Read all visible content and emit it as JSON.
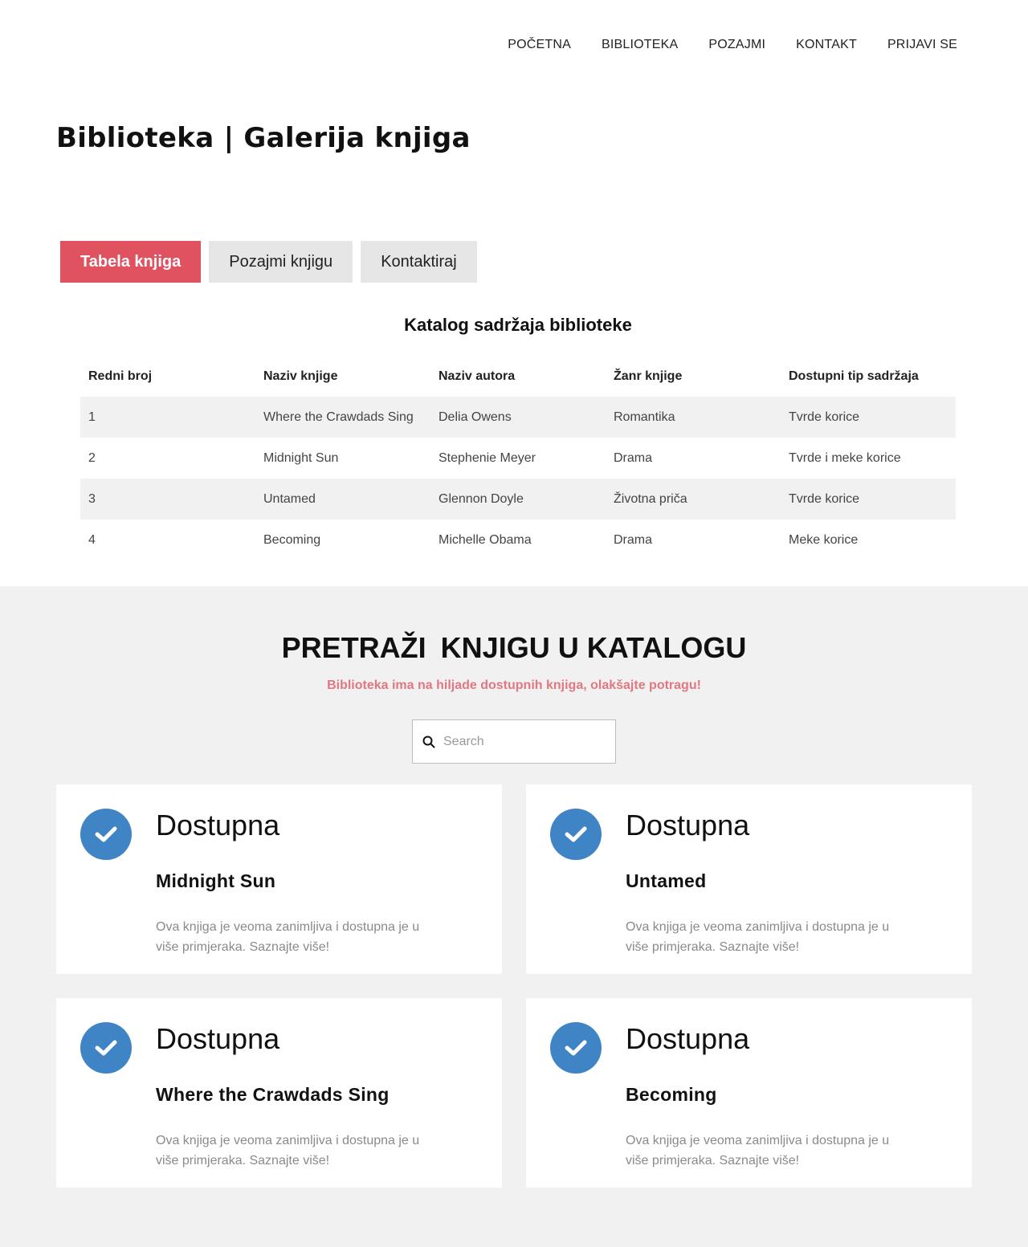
{
  "nav": {
    "items": [
      "POČETNA",
      "BIBLIOTEKA",
      "POZAJMI",
      "KONTAKT",
      "PRIJAVI SE"
    ]
  },
  "page_title": "Biblioteka | Galerija knjiga",
  "tabs": [
    {
      "label": "Tabela knjiga",
      "active": true
    },
    {
      "label": "Pozajmi knjigu",
      "active": false
    },
    {
      "label": "Kontaktiraj",
      "active": false
    }
  ],
  "catalog": {
    "title": "Katalog sadržaja biblioteke",
    "headers": [
      "Redni broj",
      "Naziv knjige",
      "Naziv autora",
      "Žanr knjige",
      "Dostupni tip sadržaja"
    ],
    "rows": [
      [
        "1",
        "Where the Crawdads Sing",
        "Delia Owens",
        "Romantika",
        "Tvrde korice"
      ],
      [
        "2",
        "Midnight Sun",
        "Stephenie Meyer",
        "Drama",
        "Tvrde i meke korice"
      ],
      [
        "3",
        "Untamed",
        "Glennon Doyle",
        "Životna priča",
        "Tvrde korice"
      ],
      [
        "4",
        "Becoming",
        "Michelle Obama",
        "Drama",
        "Meke korice"
      ]
    ]
  },
  "search": {
    "heading_strong": "PRETRAŽI",
    "heading_rest": "KNJIGU U KATALOGU",
    "subtitle": "Biblioteka ima na hiljade dostupnih knjiga, olakšajte potragu!",
    "placeholder": "Search"
  },
  "cards": [
    {
      "status": "Dostupna",
      "book": "Midnight Sun",
      "desc": "Ova knjiga je veoma zanimljiva i dostupna je u više primjeraka. Saznajte više!"
    },
    {
      "status": "Dostupna",
      "book": "Untamed",
      "desc": "Ova knjiga je veoma zanimljiva i dostupna je u više primjeraka. Saznajte više!"
    },
    {
      "status": "Dostupna",
      "book": "Where the Crawdads Sing",
      "desc": "Ova knjiga je veoma zanimljiva i dostupna je u više primjeraka. Saznajte više!"
    },
    {
      "status": "Dostupna",
      "book": "Becoming",
      "desc": "Ova knjiga je veoma zanimljiva i dostupna je u više primjeraka. Saznajte više!"
    }
  ],
  "colors": {
    "accent": "#e05260",
    "check": "#3f84c4",
    "subtitle": "#e07882"
  },
  "icons": {
    "search": "search-icon",
    "check": "check-circle-icon"
  }
}
